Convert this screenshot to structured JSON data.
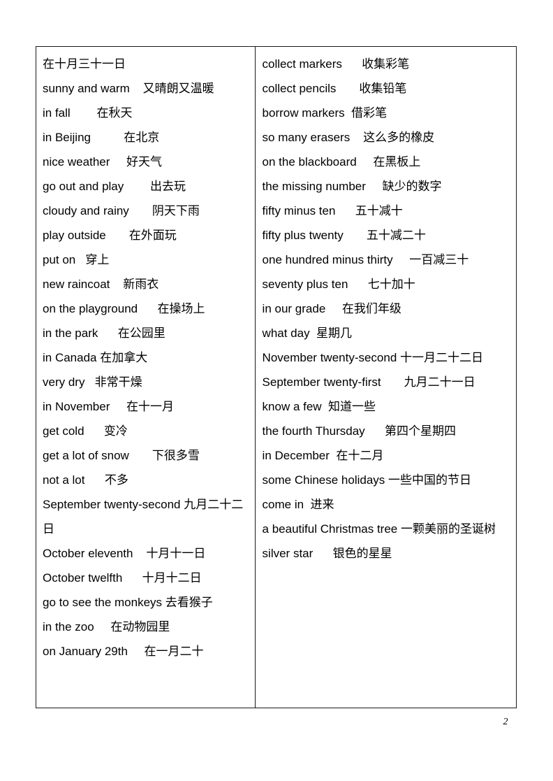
{
  "document": {
    "page_number": "2",
    "table": {
      "columns": [
        {
          "name": "left-column",
          "entries": [
            "在十月三十一日",
            "sunny and warm    又晴朗又温暖",
            "in fall        在秋天",
            "in Beijing          在北京",
            "nice weather     好天气",
            "go out and play        出去玩",
            "cloudy and rainy       阴天下雨",
            "play outside       在外面玩",
            "put on   穿上",
            "new raincoat    新雨衣",
            "on the playground      在操场上",
            "in the park      在公园里",
            "in Canada 在加拿大",
            "very dry   非常干燥",
            "in November     在十一月",
            "get cold      变冷",
            "get a lot of snow       下很多雪",
            "not a lot      不多",
            "September twenty-second 九月二十二日",
            "October eleventh    十月十一日",
            "October twelfth      十月十二日",
            "go to see the monkeys 去看猴子",
            "in the zoo     在动物园里",
            "on January 29th     在一月二十"
          ]
        },
        {
          "name": "right-column",
          "entries": [
            "collect markers      收集彩笔",
            "collect pencils       收集铅笔",
            "borrow markers  借彩笔",
            "so many erasers    这么多的橡皮",
            "on the blackboard     在黑板上",
            "the missing number     缺少的数字",
            "fifty minus ten      五十减十",
            "fifty plus twenty       五十减二十",
            "one hundred minus thirty     一百减三十",
            "seventy plus ten      七十加十",
            "in our grade     在我们年级",
            "what day  星期几",
            "November twenty-second 十一月二十二日",
            "September twenty-first       九月二十一日",
            "know a few  知道一些",
            "the fourth Thursday      第四个星期四",
            "in December  在十二月",
            "some Chinese holidays 一些中国的节日",
            "come in  进来",
            "a beautiful Christmas tree 一颗美丽的圣诞树",
            "silver star      银色的星星"
          ]
        }
      ]
    }
  }
}
